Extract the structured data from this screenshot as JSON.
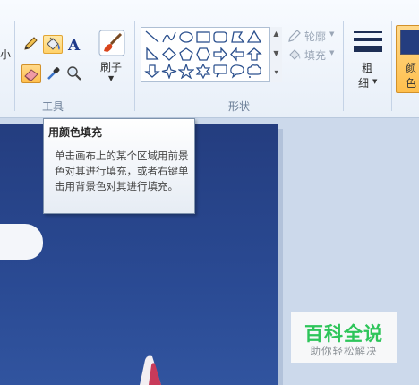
{
  "ribbon": {
    "groups": {
      "tools_label": "工具",
      "shapes_label": "形状"
    },
    "left_edge_label": "小",
    "brush_label": "刷子",
    "outline_label": "轮廓",
    "fill_label": "填充",
    "size_label_line1": "粗",
    "size_label_line2": "细",
    "color_label_line1": "颜",
    "color_label_line2": "色"
  },
  "tooltip": {
    "title": "用颜色填充",
    "body": "单击画布上的某个区域用前景色对其进行填充，或者右键单击用背景色对其进行填充。"
  },
  "watermark": {
    "title": "百科全说",
    "subtitle": "助你轻松解决"
  },
  "colors": {
    "accent_selected": "#ffd26b",
    "canvas_blue": "#2a4a93",
    "watermark_green": "#2ec55a"
  }
}
